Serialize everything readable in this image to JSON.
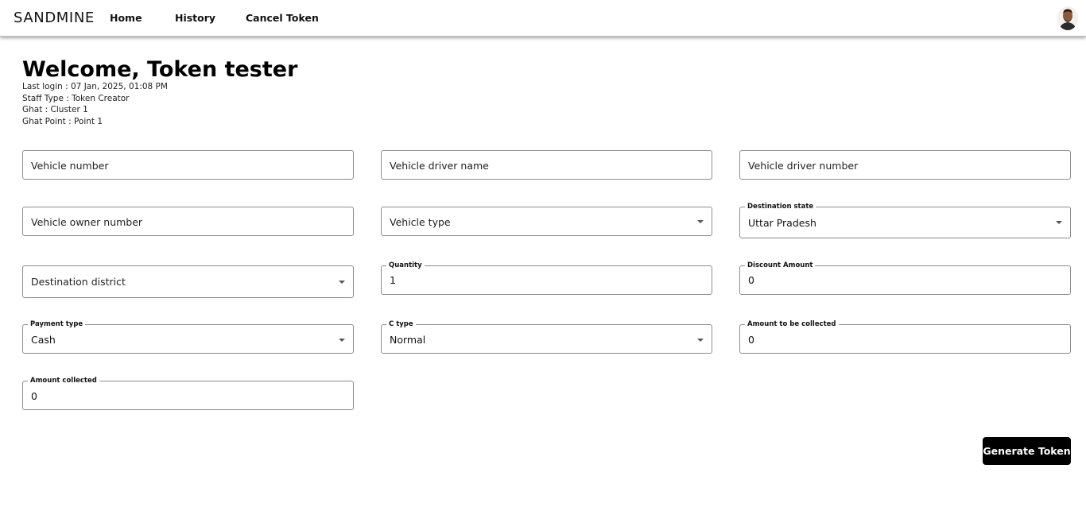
{
  "nav": {
    "brand": "SANDMINE",
    "links": [
      "Home",
      "History",
      "Cancel Token"
    ]
  },
  "header": {
    "title": "Welcome, Token tester",
    "last_login": "Last login : 07 Jan, 2025, 01:08 PM",
    "staff_type": "Staff Type : Token Creator",
    "ghat": "Ghat : Cluster 1",
    "ghat_point": "Ghat Point : Point 1"
  },
  "form": {
    "vehicle_number": {
      "placeholder": "Vehicle number"
    },
    "vehicle_driver_name": {
      "placeholder": "Vehicle driver name"
    },
    "vehicle_driver_number": {
      "placeholder": "Vehicle driver number"
    },
    "vehicle_owner_number": {
      "placeholder": "Vehicle owner number"
    },
    "vehicle_type": {
      "placeholder": "Vehicle type"
    },
    "destination_state": {
      "label": "Destination state",
      "value": "Uttar Pradesh"
    },
    "destination_district": {
      "placeholder": "Destination district"
    },
    "quantity": {
      "label": "Quantity",
      "value": "1"
    },
    "discount_amount": {
      "label": "Discount Amount",
      "value": "0"
    },
    "payment_type": {
      "label": "Payment type",
      "value": "Cash"
    },
    "c_type": {
      "label": "C type",
      "value": "Normal"
    },
    "amount_to_be_collected": {
      "label": "Amount to be collected",
      "value": "0"
    },
    "amount_collected": {
      "label": "Amount collected",
      "value": "0"
    }
  },
  "actions": {
    "generate": "Generate Token"
  },
  "icons": {
    "avatar": "user-avatar",
    "caret": "caret-down-icon"
  }
}
